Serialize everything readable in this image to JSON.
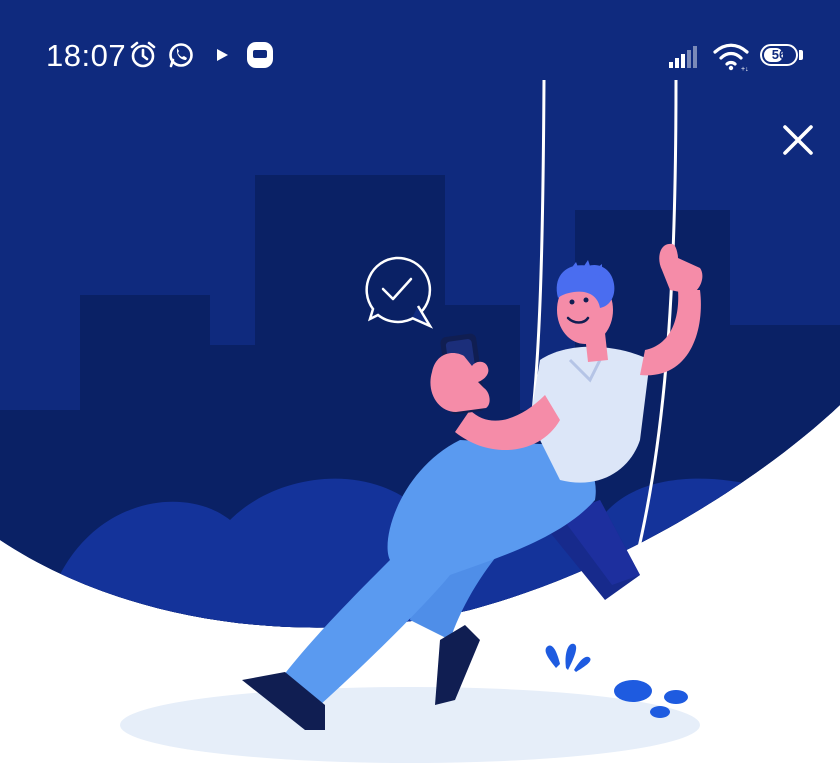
{
  "status_bar": {
    "time": "18:07",
    "battery_level": "56",
    "left_icons": [
      "alarm-icon",
      "whatsapp-icon",
      "play-icon",
      "app-notification-icon"
    ],
    "right_icons": [
      "signal-icon",
      "wifi-icon",
      "battery-icon"
    ]
  },
  "header": {
    "close_icon": "close-icon"
  },
  "illustration": {
    "subject": "person-on-swing-with-phone",
    "elements": [
      "city-skyline",
      "checkmark-speech-bubble",
      "swing",
      "plant",
      "pebbles",
      "ground-shadow"
    ]
  },
  "colors": {
    "background_dark": "#0f2a7e",
    "skyline": "#0a2165",
    "hills": "#14339a",
    "skin": "#f58ca8",
    "shirt": "#dce6f8",
    "pants": "#5a9af0",
    "shoes": "#101e52",
    "hair": "#4a6df0",
    "white": "#ffffff"
  }
}
